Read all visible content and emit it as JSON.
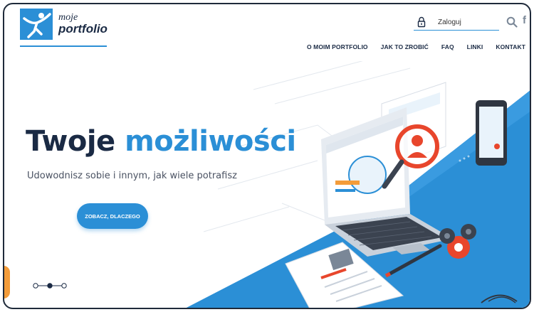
{
  "header": {
    "logo_line1": "moje",
    "logo_line2": "portfolio",
    "login_placeholder": "Zaloguj",
    "facebook_glyph": "f",
    "icons": [
      "lock-icon",
      "search-icon",
      "facebook-icon"
    ]
  },
  "nav": {
    "items": [
      "O MOIM PORTFOLIO",
      "JAK TO ZROBIĆ",
      "FAQ",
      "LINKI",
      "KONTAKT"
    ]
  },
  "hero": {
    "title_part1": "Twoje",
    "title_part2": "możliwości",
    "subtitle": "Udowodnisz sobie i innym, jak wiele potrafisz",
    "cta_label": "ZOBACZ, DLACZEGO"
  },
  "slider": {
    "count": 3,
    "active_index": 1
  },
  "colors": {
    "accent": "#2b8fd6",
    "dark": "#1a2a44",
    "orange": "#f39c3a",
    "gear_red": "#e8462c"
  }
}
